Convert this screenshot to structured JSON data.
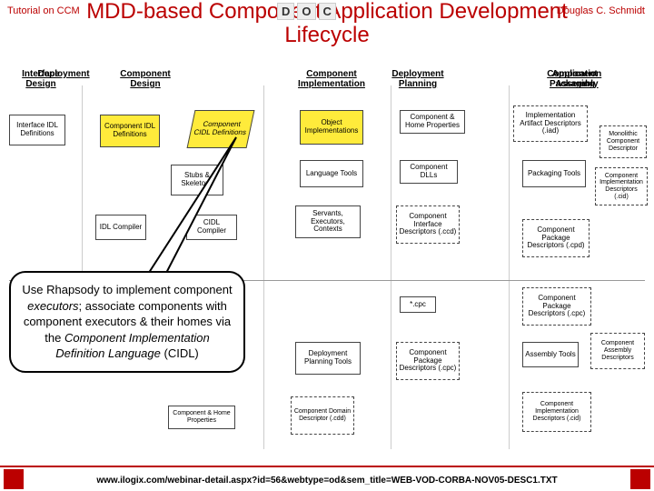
{
  "header": {
    "tutorial": "Tutorial on CCM",
    "author": "Douglas C. Schmidt",
    "logo": [
      "D",
      "O",
      "C"
    ],
    "title_line1": "MDD-based Component Application Development",
    "title_line2": "Lifecycle"
  },
  "columns": {
    "c1": "Interface\nDesign",
    "c2": "Component\nDesign",
    "c3": "Component\nImplementation",
    "c4": "Component\nPackaging",
    "c5": "Deployment",
    "c6": "Deployment\nPlanning",
    "c7": "Application\nAssembly"
  },
  "boxes": {
    "b1": "Interface IDL\nDefinitions",
    "b2": "Component\nIDL\nDefinitions",
    "b3": "Component\nCIDL\nDefinitions",
    "b4": "Stubs\n&\nSkeletons",
    "b5": "IDL\nCompiler",
    "b6": "CIDL\nCompiler",
    "b7": "Object\nImplementations",
    "b8": "Language\nTools",
    "b9": "Servants,\nExecutors,\nContexts",
    "b10": "Component\nDLLs",
    "b11": "Component\nInterface\nDescriptors\n(.ccd)",
    "b12": "Component &\nHome Properties",
    "b13": "Implementation\nArtifact\nDescriptors\n(.iad)",
    "b14": "Packaging\nTools",
    "b15": "Monolithic\nComponent\nDescriptor",
    "b16": "Component\nImplementation\nDescriptors\n(.cid)",
    "b17": "Component\nPackage\nDescriptors\n(.cpd)",
    "b18": "Component &\nHome Properties",
    "b19": "Deployment\nPlanning\nTools",
    "b20": "Component\nDomain\nDescriptor\n(.cdd)",
    "b21": "Component\nPackage\nDescriptors\n(.cpc)",
    "b22": "*.cpc",
    "b23": "Assembly\nTools",
    "b24": "Component\nAssembly\nDescriptors",
    "b25": "Component\nImplementation\nDescriptors\n(.cid)"
  },
  "callout": {
    "text_1": "Use Rhapsody to implement component ",
    "em1": "executors",
    "text_2": "; associate components with component executors & their homes via the ",
    "em2": "Component Implementation Definition Language",
    "text_3": " (CIDL)"
  },
  "footer": {
    "url": "www.ilogix.com/webinar-detail.aspx?id=56&webtype=od&sem_title=WEB-VOD-CORBA-NOV05-DESC1.TXT"
  }
}
